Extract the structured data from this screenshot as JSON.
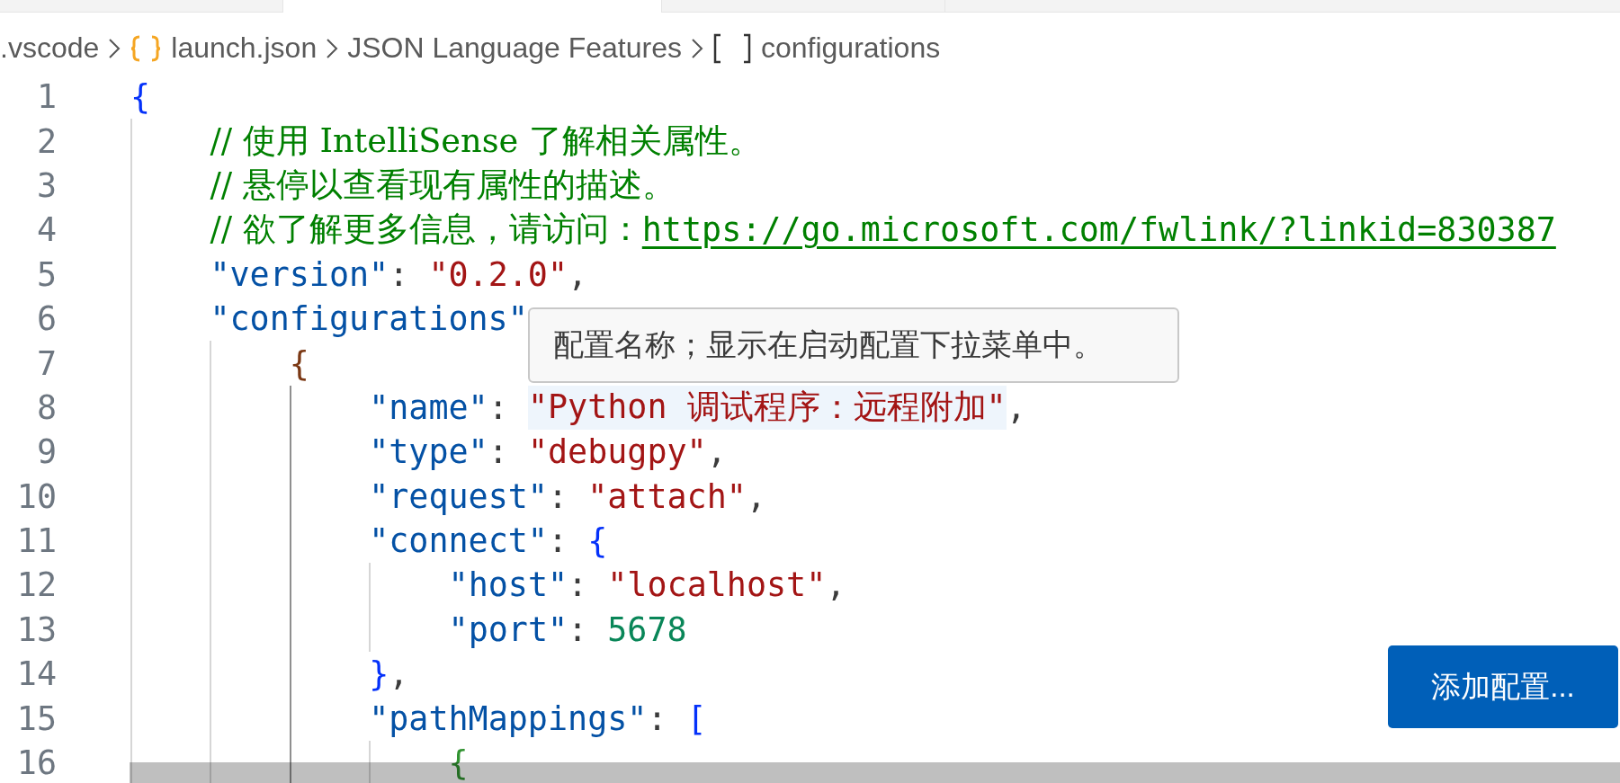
{
  "tabs": [
    {
      "selected": false
    },
    {
      "selected": true
    },
    {
      "selected": false
    }
  ],
  "breadcrumb": [
    {
      "kind": "folder",
      "label": ".vscode"
    },
    {
      "kind": "object",
      "label": "launch.json"
    },
    {
      "kind": "plain",
      "label": "JSON Language Features"
    },
    {
      "kind": "array",
      "label": "configurations"
    }
  ],
  "lines": [
    {
      "number": "1",
      "tokens": [
        {
          "kind": "bracket",
          "text": "{",
          "color": "#0431fa"
        }
      ]
    },
    {
      "number": "2",
      "guides": [
        {
          "active": false
        }
      ],
      "tokens": [
        {
          "kind": "comment",
          "text": "// 使用 IntelliSense 了解相关属性。"
        }
      ]
    },
    {
      "number": "3",
      "guides": [
        {
          "active": false
        }
      ],
      "tokens": [
        {
          "kind": "comment",
          "text": "// 悬停以查看现有属性的描述。"
        }
      ]
    },
    {
      "number": "4",
      "guides": [
        {
          "active": false
        }
      ],
      "tokens": [
        {
          "kind": "comment",
          "text": "// 欲了解更多信息，请访问："
        },
        {
          "kind": "link",
          "text": "https://go.microsoft.com/fwlink/?linkid=830387"
        }
      ]
    },
    {
      "number": "5",
      "guides": [
        {
          "active": false
        }
      ],
      "tokens": [
        {
          "kind": "key",
          "text": "\"version\""
        },
        {
          "kind": "punct",
          "text": ": "
        },
        {
          "kind": "string",
          "text": "\"0.2.0\""
        },
        {
          "kind": "punct",
          "text": ","
        }
      ]
    },
    {
      "number": "6",
      "guides": [
        {
          "active": false
        }
      ],
      "tokens": [
        {
          "kind": "key",
          "text": "\"configurations\""
        }
      ]
    },
    {
      "number": "7",
      "guides": [
        {
          "active": false
        },
        {
          "active": false
        }
      ],
      "tokens": [
        {
          "kind": "bracket",
          "text": "{",
          "color": "#7b3814"
        }
      ]
    },
    {
      "number": "8",
      "guides": [
        {
          "active": false
        },
        {
          "active": false
        },
        {
          "active": true
        }
      ],
      "tokens": [
        {
          "kind": "key",
          "text": "\"name\""
        },
        {
          "kind": "punct",
          "text": ": "
        },
        {
          "kind": "string",
          "text": "\"Python 调试程序：远程附加\"",
          "hovered": true
        },
        {
          "kind": "punct",
          "text": ","
        }
      ]
    },
    {
      "number": "9",
      "guides": [
        {
          "active": false
        },
        {
          "active": false
        },
        {
          "active": true
        }
      ],
      "tokens": [
        {
          "kind": "key",
          "text": "\"type\""
        },
        {
          "kind": "punct",
          "text": ": "
        },
        {
          "kind": "string",
          "text": "\"debugpy\""
        },
        {
          "kind": "punct",
          "text": ","
        }
      ]
    },
    {
      "number": "10",
      "guides": [
        {
          "active": false
        },
        {
          "active": false
        },
        {
          "active": true
        }
      ],
      "tokens": [
        {
          "kind": "key",
          "text": "\"request\""
        },
        {
          "kind": "punct",
          "text": ": "
        },
        {
          "kind": "string",
          "text": "\"attach\""
        },
        {
          "kind": "punct",
          "text": ","
        }
      ]
    },
    {
      "number": "11",
      "guides": [
        {
          "active": false
        },
        {
          "active": false
        },
        {
          "active": true
        }
      ],
      "tokens": [
        {
          "kind": "key",
          "text": "\"connect\""
        },
        {
          "kind": "punct",
          "text": ": "
        },
        {
          "kind": "bracket",
          "text": "{",
          "color": "#0431fa"
        }
      ]
    },
    {
      "number": "12",
      "guides": [
        {
          "active": false
        },
        {
          "active": false
        },
        {
          "active": true
        },
        {
          "active": false
        }
      ],
      "tokens": [
        {
          "kind": "key",
          "text": "\"host\""
        },
        {
          "kind": "punct",
          "text": ": "
        },
        {
          "kind": "string",
          "text": "\"localhost\""
        },
        {
          "kind": "punct",
          "text": ","
        }
      ]
    },
    {
      "number": "13",
      "guides": [
        {
          "active": false
        },
        {
          "active": false
        },
        {
          "active": true
        },
        {
          "active": false
        }
      ],
      "tokens": [
        {
          "kind": "key",
          "text": "\"port\""
        },
        {
          "kind": "punct",
          "text": ": "
        },
        {
          "kind": "number",
          "text": "5678"
        }
      ]
    },
    {
      "number": "14",
      "guides": [
        {
          "active": false
        },
        {
          "active": false
        },
        {
          "active": true
        }
      ],
      "tokens": [
        {
          "kind": "bracket",
          "text": "}",
          "color": "#0431fa"
        },
        {
          "kind": "punct",
          "text": ","
        }
      ]
    },
    {
      "number": "15",
      "guides": [
        {
          "active": false
        },
        {
          "active": false
        },
        {
          "active": true
        }
      ],
      "tokens": [
        {
          "kind": "key",
          "text": "\"pathMappings\""
        },
        {
          "kind": "punct",
          "text": ": "
        },
        {
          "kind": "bracket",
          "text": "[",
          "color": "#0431fa"
        }
      ]
    },
    {
      "number": "16",
      "guides": [
        {
          "active": false
        },
        {
          "active": false
        },
        {
          "active": true
        },
        {
          "active": false
        }
      ],
      "tokens": [
        {
          "kind": "bracket",
          "text": "{",
          "color": "#319331"
        }
      ]
    }
  ],
  "tooltip": {
    "text": "配置名称；显示在启动配置下拉菜单中。"
  },
  "add_button": {
    "label": "添加配置..."
  }
}
